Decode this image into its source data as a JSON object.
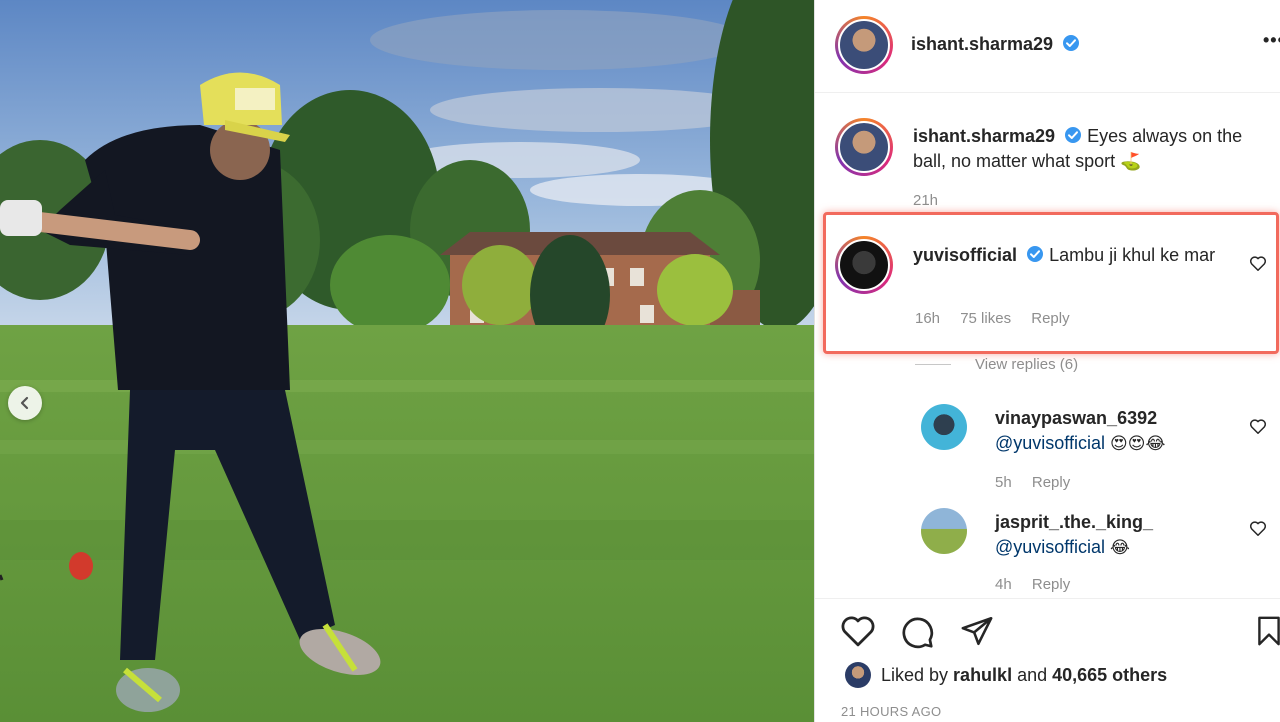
{
  "post_author": {
    "username": "ishant.sharma29",
    "verified": true,
    "more_label": "•••"
  },
  "caption": {
    "username": "ishant.sharma29",
    "text": "Eyes always on the ball, no matter what sport",
    "emoji": "⛳",
    "time": "21h"
  },
  "comments": [
    {
      "username": "yuvisofficial",
      "text": "Lambu ji khul ke mar",
      "time": "16h",
      "likes": "75 likes",
      "reply": "Reply",
      "highlighted": true
    }
  ],
  "view_replies": "View replies (6)",
  "replies": [
    {
      "username": "vinaypaswan_6392",
      "mention": "@yuvisofficial",
      "emoji": "😍😍😂",
      "time": "5h",
      "reply": "Reply"
    },
    {
      "username": "jasprit_.the._king_",
      "mention": "@yuvisofficial",
      "emoji": "😂",
      "time": "4h",
      "reply": "Reply"
    }
  ],
  "likes": {
    "prefix": "Liked by",
    "user": "rahulkl",
    "middle": "and",
    "count": "40,665 others"
  },
  "timestamp": "21 HOURS AGO",
  "colors": {
    "verified": "#3897f0",
    "highlight": "#f26a5d",
    "muted": "#8e8e8e"
  }
}
